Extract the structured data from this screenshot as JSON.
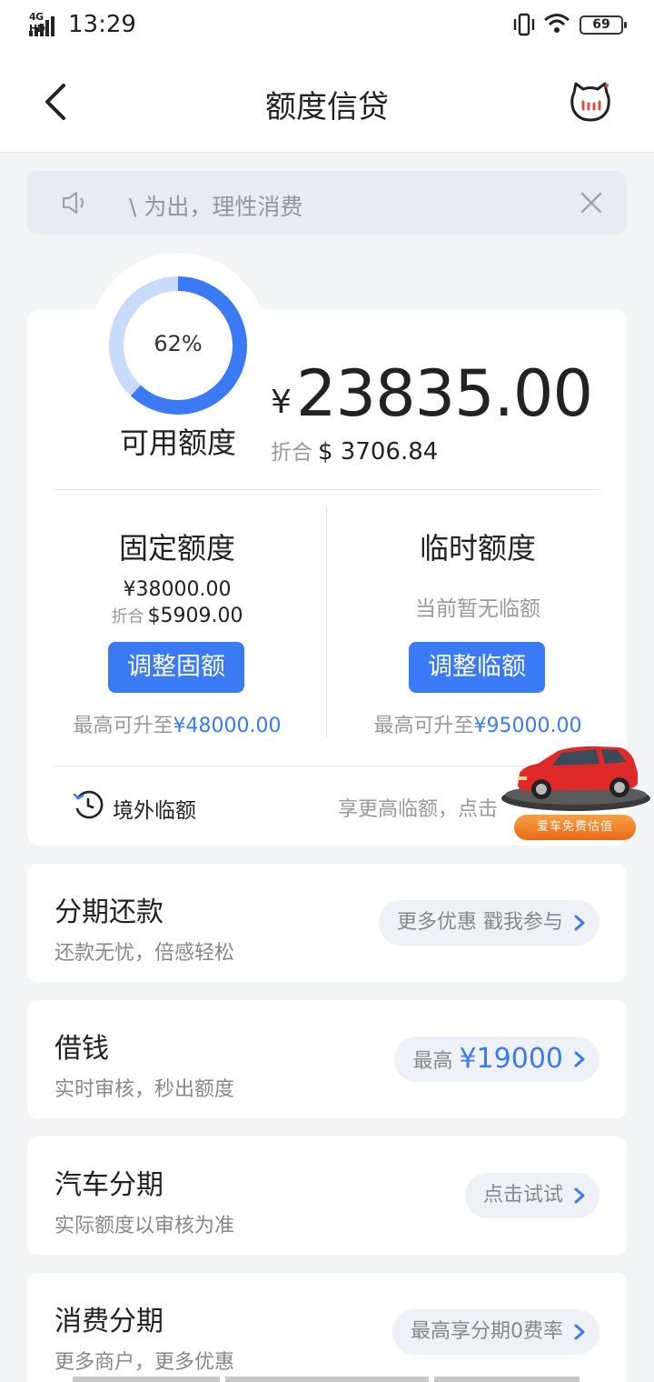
{
  "status_bar": {
    "network": "4G HD",
    "time": "13:29",
    "battery": "69"
  },
  "header": {
    "title": "额度信贷",
    "back_icon": "chevron-left-icon",
    "service_icon": "cat-service-icon"
  },
  "notice": {
    "text": "\\ 为出，理性消费",
    "icon": "speaker-icon"
  },
  "credit": {
    "usage_percent": 62,
    "percent_label": "62%",
    "available_label": "可用额度",
    "currency_symbol": "¥",
    "available_amount": "23835.00",
    "converted_prefix": "折合",
    "converted_amount": "$ 3706.84"
  },
  "fixed_limit": {
    "title": "固定额度",
    "amount": "¥38000.00",
    "converted_prefix": "折合",
    "converted_amount": "$5909.00",
    "button_label": "调整固额",
    "max_prefix": "最高可升至",
    "max_value": "¥48000.00"
  },
  "temp_limit": {
    "title": "临时额度",
    "subtitle": "当前暂无临额",
    "button_label": "调整临额",
    "max_prefix": "最高可升至",
    "max_value": "¥95000.00"
  },
  "abroad": {
    "label": "境外临额",
    "desc": "享更高临额，点击"
  },
  "car_ad": {
    "badge": "爱车免费估值"
  },
  "services": [
    {
      "title": "分期还款",
      "subtitle": "还款无忧，倍感轻松",
      "pill": "更多优惠 戳我参与"
    },
    {
      "title": "借钱",
      "subtitle": "实时审核，秒出额度",
      "pill_prefix": "最高",
      "pill_value": "¥19000"
    },
    {
      "title": "汽车分期",
      "subtitle": "实际额度以审核为准",
      "pill": "点击试试"
    },
    {
      "title": "消费分期",
      "subtitle": "更多商户，更多优惠",
      "pill": "最高享分期0费率"
    }
  ],
  "colors": {
    "accent": "#3b7af5",
    "donut_track": "#c9dbfb",
    "page_bg": "#f3f4f6"
  }
}
